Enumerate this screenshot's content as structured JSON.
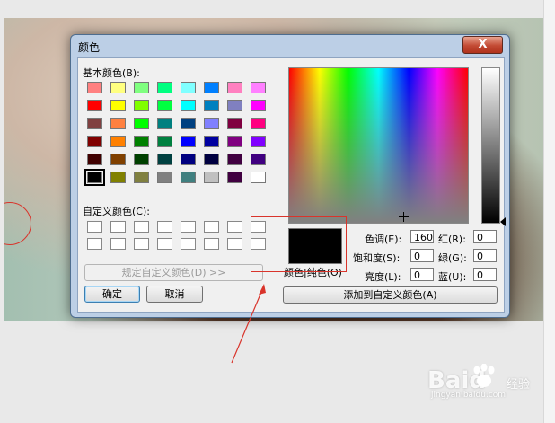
{
  "dialog": {
    "title": "颜色",
    "close_label": "X",
    "basic_colors_label": "基本颜色(B):",
    "custom_colors_label": "自定义颜色(C):",
    "define_custom_button": "规定自定义颜色(D) >>",
    "ok_button": "确定",
    "cancel_button": "取消",
    "add_custom_button": "添加到自定义颜色(A)",
    "color_solid_label": "颜色|纯色(O)",
    "fields": {
      "hue_label": "色调(E):",
      "hue_value": "160",
      "sat_label": "饱和度(S):",
      "sat_value": "0",
      "lum_label": "亮度(L):",
      "lum_value": "0",
      "red_label": "红(R):",
      "red_value": "0",
      "green_label": "绿(G):",
      "green_value": "0",
      "blue_label": "蓝(U):",
      "blue_value": "0"
    },
    "basic_colors": [
      [
        "#ff8080",
        "#ffff80",
        "#80ff80",
        "#00ff80",
        "#80ffff",
        "#0080ff",
        "#ff80c0",
        "#ff80ff"
      ],
      [
        "#ff0000",
        "#ffff00",
        "#80ff00",
        "#00ff40",
        "#00ffff",
        "#0080c0",
        "#8080c0",
        "#ff00ff"
      ],
      [
        "#804040",
        "#ff8040",
        "#00ff00",
        "#008080",
        "#004080",
        "#8080ff",
        "#800040",
        "#ff0080"
      ],
      [
        "#800000",
        "#ff8000",
        "#008000",
        "#008040",
        "#0000ff",
        "#0000a0",
        "#800080",
        "#8000ff"
      ],
      [
        "#400000",
        "#804000",
        "#004000",
        "#004040",
        "#000080",
        "#000040",
        "#400040",
        "#400080"
      ],
      [
        "#000000",
        "#808000",
        "#808040",
        "#808080",
        "#408080",
        "#c0c0c0",
        "#400040",
        "#ffffff"
      ]
    ],
    "selected_color": "#000000"
  },
  "watermark": {
    "brand": "Baid",
    "sub": "经验",
    "url": "jingyan.baidu.com"
  }
}
